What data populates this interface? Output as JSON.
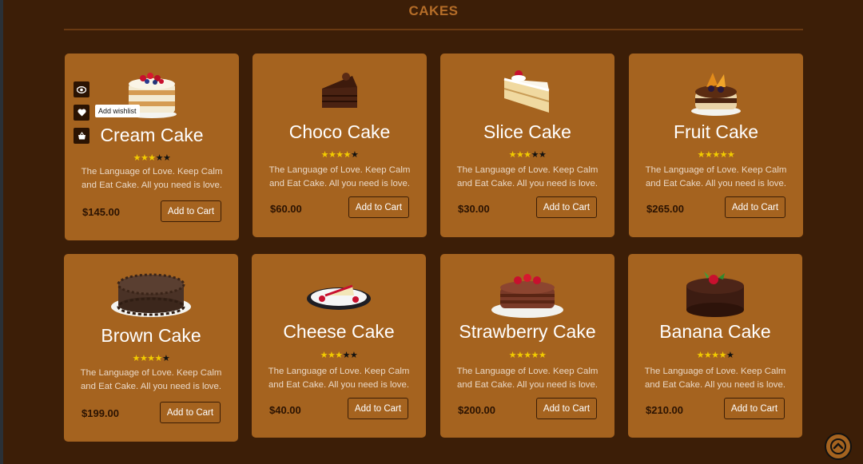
{
  "section": {
    "title": "CAKES"
  },
  "products": [
    {
      "name": "Cream Cake",
      "rating": 3,
      "max_rating": 5,
      "stars_on": "★★★",
      "stars_off": "★★",
      "description": "The Language of Love. Keep Calm and Eat Cake. All you need is love.",
      "price": "$145.00",
      "cart_label": "Add to Cart",
      "image_icon": "cream-cake-image"
    },
    {
      "name": "Choco Cake",
      "rating": 4,
      "max_rating": 5,
      "stars_on": "★★★★",
      "stars_off": "★",
      "description": "The Language of Love. Keep Calm and Eat Cake. All you need is love.",
      "price": "$60.00",
      "cart_label": "Add to Cart",
      "image_icon": "choco-cake-image"
    },
    {
      "name": "Slice Cake",
      "rating": 3,
      "max_rating": 5,
      "stars_on": "★★★",
      "stars_off": "★★",
      "description": "The Language of Love. Keep Calm and Eat Cake. All you need is love.",
      "price": "$30.00",
      "cart_label": "Add to Cart",
      "image_icon": "slice-cake-image"
    },
    {
      "name": "Fruit Cake",
      "rating": 5,
      "max_rating": 5,
      "stars_on": "★★★★★",
      "stars_off": "",
      "description": "The Language of Love. Keep Calm and Eat Cake. All you need is love.",
      "price": "$265.00",
      "cart_label": "Add to Cart",
      "image_icon": "fruit-cake-image"
    },
    {
      "name": "Brown Cake",
      "rating": 4,
      "max_rating": 5,
      "stars_on": "★★★★",
      "stars_off": "★",
      "description": "The Language of Love. Keep Calm and Eat Cake. All you need is love.",
      "price": "$199.00",
      "cart_label": "Add to Cart",
      "image_icon": "brown-cake-image"
    },
    {
      "name": "Cheese Cake",
      "rating": 3,
      "max_rating": 5,
      "stars_on": "★★★",
      "stars_off": "★★",
      "description": "The Language of Love. Keep Calm and Eat Cake. All you need is love.",
      "price": "$40.00",
      "cart_label": "Add to Cart",
      "image_icon": "cheese-cake-image"
    },
    {
      "name": "Strawberry Cake",
      "rating": 5,
      "max_rating": 5,
      "stars_on": "★★★★★",
      "stars_off": "",
      "description": "The Language of Love. Keep Calm and Eat Cake. All you need is love.",
      "price": "$200.00",
      "cart_label": "Add to Cart",
      "image_icon": "strawberry-cake-image"
    },
    {
      "name": "Banana Cake",
      "rating": 4,
      "max_rating": 5,
      "stars_on": "★★★★",
      "stars_off": "★",
      "description": "The Language of Love. Keep Calm and Eat Cake. All you need is love.",
      "price": "$210.00",
      "cart_label": "Add to Cart",
      "image_icon": "banana-cake-image"
    }
  ],
  "hover_actions": {
    "icons": [
      "eye-icon",
      "heart-icon",
      "basket-icon"
    ],
    "tooltip": "Add wishlist"
  },
  "scroll_top": {
    "icon": "chevron-up-icon"
  },
  "colors": {
    "background": "#3c1e07",
    "card": "#a5631f",
    "title": "#b56d28",
    "star_on": "#f2cc00"
  }
}
